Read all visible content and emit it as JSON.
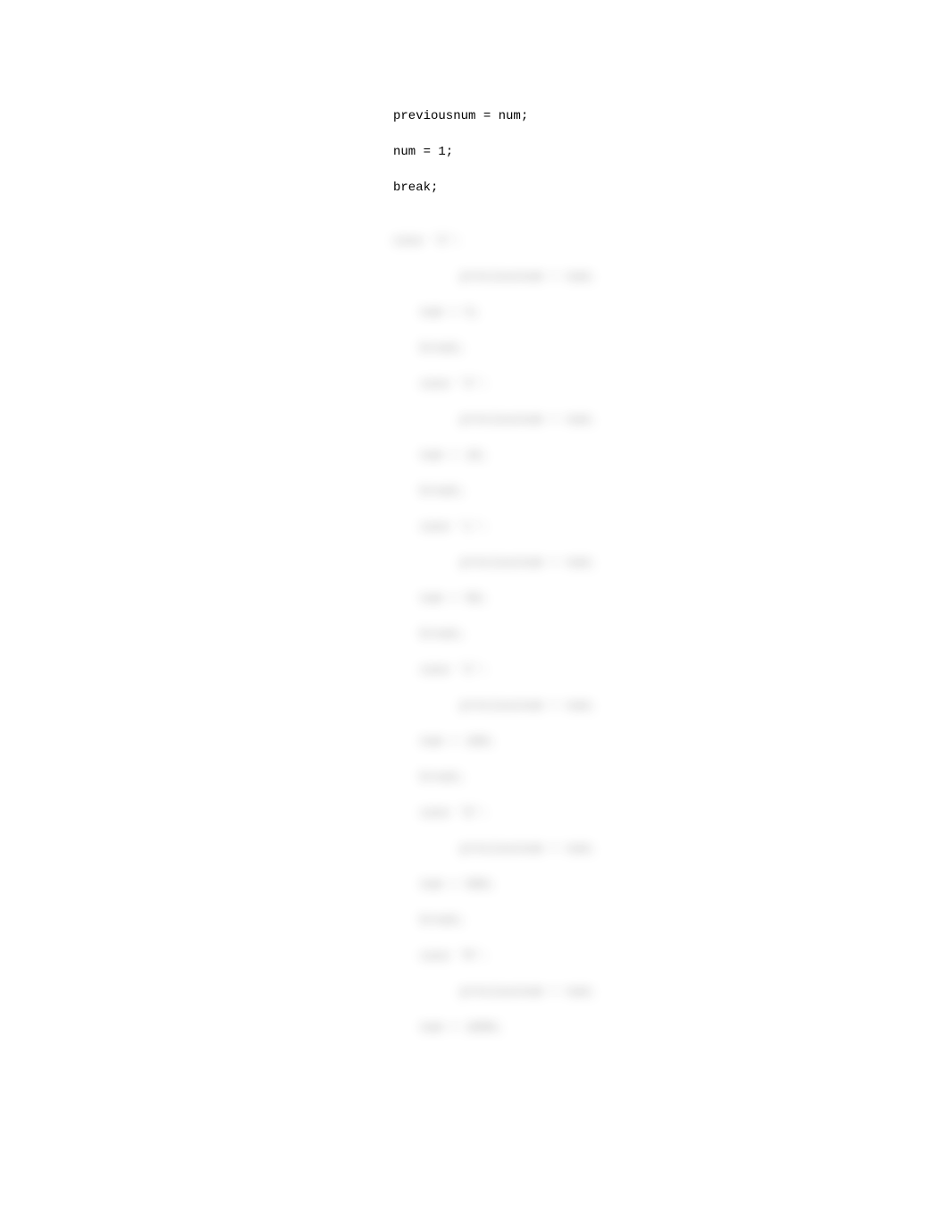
{
  "code": {
    "clear_lines": [
      "previousnum = num;",
      "num = 1;",
      "break;"
    ],
    "blurred_lines": [
      {
        "text": "case 'X':",
        "indent": 0
      },
      {
        "text": "previousnum = num;",
        "indent": 2
      },
      {
        "text": "num = 5;",
        "indent": 1
      },
      {
        "text": "break;",
        "indent": 1
      },
      {
        "text": "case 'X':",
        "indent": 1
      },
      {
        "text": "previousnum = num;",
        "indent": 2
      },
      {
        "text": "num = 10;",
        "indent": 1
      },
      {
        "text": "break;",
        "indent": 1
      },
      {
        "text": "case 'L':",
        "indent": 1
      },
      {
        "text": "previousnum = num;",
        "indent": 2
      },
      {
        "text": "num = 50;",
        "indent": 1
      },
      {
        "text": "break;",
        "indent": 1
      },
      {
        "text": "case 'C':",
        "indent": 1
      },
      {
        "text": "previousnum = num;",
        "indent": 2
      },
      {
        "text": "num = 100;",
        "indent": 1
      },
      {
        "text": "break;",
        "indent": 1
      },
      {
        "text": "case 'D':",
        "indent": 1
      },
      {
        "text": "previousnum = num;",
        "indent": 2
      },
      {
        "text": "num = 500;",
        "indent": 1
      },
      {
        "text": "break;",
        "indent": 1
      },
      {
        "text": "case 'M':",
        "indent": 1
      },
      {
        "text": "previousnum = num;",
        "indent": 2
      },
      {
        "text": "num = 1000;",
        "indent": 1
      }
    ]
  }
}
